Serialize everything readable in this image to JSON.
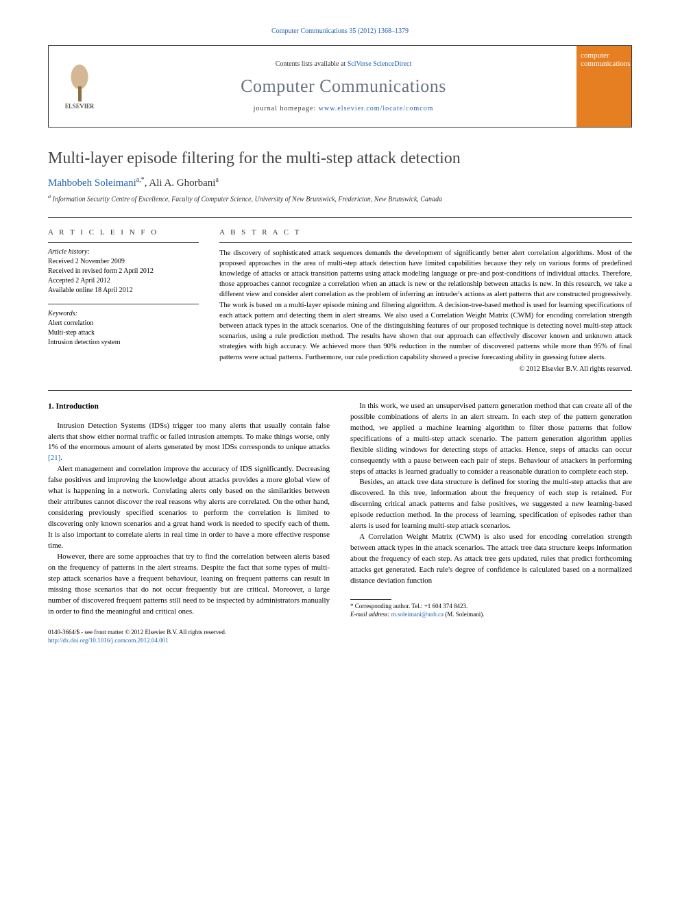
{
  "header": {
    "citation": "Computer Communications 35 (2012) 1368–1379"
  },
  "journal_box": {
    "elsevier_label": "ELSEVIER",
    "contents_prefix": "Contents lists available at ",
    "contents_link": "SciVerse ScienceDirect",
    "journal_name": "Computer Communications",
    "homepage_prefix": "journal homepage: ",
    "homepage_link": "www.elsevier.com/locate/comcom",
    "cover_text": "computer communications"
  },
  "article": {
    "title": "Multi-layer episode filtering for the multi-step attack detection",
    "authors_html": "Mahbobeh Soleimani",
    "author1_sup": "a,*",
    "author2": ", Ali A. Ghorbani",
    "author2_sup": "a",
    "affiliation": "Information Security Centre of Excellence, Faculty of Computer Science, University of New Brunswick, Fredericton, New Brunswick, Canada",
    "affiliation_sup": "a"
  },
  "info": {
    "header": "A R T I C L E   I N F O",
    "history_label": "Article history:",
    "history": [
      "Received 2 November 2009",
      "Received in revised form 2 April 2012",
      "Accepted 2 April 2012",
      "Available online 18 April 2012"
    ],
    "keywords_label": "Keywords:",
    "keywords": [
      "Alert correlation",
      "Multi-step attack",
      "Intrusion detection system"
    ]
  },
  "abstract": {
    "header": "A B S T R A C T",
    "text": "The discovery of sophisticated attack sequences demands the development of significantly better alert correlation algorithms. Most of the proposed approaches in the area of multi-step attack detection have limited capabilities because they rely on various forms of predefined knowledge of attacks or attack transition patterns using attack modeling language or pre-and post-conditions of individual attacks. Therefore, those approaches cannot recognize a correlation when an attack is new or the relationship between attacks is new. In this research, we take a different view and consider alert correlation as the problem of inferring an intruder's actions as alert patterns that are constructed progressively. The work is based on a multi-layer episode mining and filtering algorithm. A decision-tree-based method is used for learning specifications of each attack pattern and detecting them in alert streams. We also used a Correlation Weight Matrix (CWM) for encoding correlation strength between attack types in the attack scenarios. One of the distinguishing features of our proposed technique is detecting novel multi-step attack scenarios, using a rule prediction method. The results have shown that our approach can effectively discover known and unknown attack strategies with high accuracy. We achieved more than 90% reduction in the number of discovered patterns while more than 95% of final patterns were actual patterns. Furthermore, our rule prediction capability showed a precise forecasting ability in guessing future alerts.",
    "copyright": "© 2012 Elsevier B.V. All rights reserved."
  },
  "body": {
    "section_title": "1. Introduction",
    "paragraphs": [
      "Intrusion Detection Systems (IDSs) trigger too many alerts that usually contain false alerts that show either normal traffic or failed intrusion attempts. To make things worse, only 1% of the enormous amount of alerts generated by most IDSs corresponds to unique attacks [21].",
      "Alert management and correlation improve the accuracy of IDS significantly. Decreasing false positives and improving the knowledge about attacks provides a more global view of what is happening in a network. Correlating alerts only based on the similarities between their attributes cannot discover the real reasons why alerts are correlated. On the other hand, considering previously specified scenarios to perform the correlation is limited to discovering only known scenarios and a great hand work is needed to specify each of them. It is also important to correlate alerts in real time in order to have a more effective response time.",
      "However, there are some approaches that try to find the correlation between alerts based on the frequency of patterns in the alert streams. Despite the fact that some types of multi-step attack scenarios have a frequent behaviour, leaning on frequent patterns can result in missing those scenarios that do not occur frequently but are critical. Moreover, a large number of discovered frequent patterns still need to be inspected by administrators manually in order to find the meaningful and critical ones.",
      "In this work, we used an unsupervised pattern generation method that can create all of the possible combinations of alerts in an alert stream. In each step of the pattern generation method, we applied a machine learning algorithm to filter those patterns that follow specifications of a multi-step attack scenario. The pattern generation algorithm applies flexible sliding windows for detecting steps of attacks. Hence, steps of attacks can occur consequently with a pause between each pair of steps. Behaviour of attackers in performing steps of attacks is learned gradually to consider a reasonable duration to complete each step.",
      "Besides, an attack tree data structure is defined for storing the multi-step attacks that are discovered. In this tree, information about the frequency of each step is retained. For discerning critical attack patterns and false positives, we suggested a new learning-based episode reduction method. In the process of learning, specification of episodes rather than alerts is used for learning multi-step attack scenarios.",
      "A Correlation Weight Matrix (CWM) is also used for encoding correlation strength between attack types in the attack scenarios. The attack tree data structure keeps information about the frequency of each step. As attack tree gets updated, rules that predict forthcoming attacks get generated. Each rule's degree of confidence is calculated based on a normalized distance deviation function"
    ],
    "ref21": "[21]"
  },
  "footnote": {
    "corresponding": "* Corresponding author. Tel.: +1 604 374 8423.",
    "email_label": "E-mail address: ",
    "email": "m.soleimani@unb.ca",
    "email_suffix": " (M. Soleimani)."
  },
  "footer": {
    "isbn": "0140-3664/$ - see front matter © 2012 Elsevier B.V. All rights reserved.",
    "doi_link": "http://dx.doi.org/10.1016/j.comcom.2012.04.001"
  }
}
